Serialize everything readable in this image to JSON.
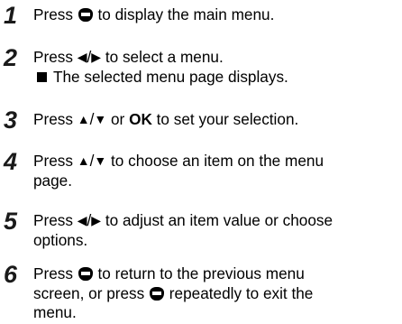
{
  "steps": [
    {
      "number": "1",
      "t1": "Press",
      "icon1": "menu-button-icon",
      "t2": "to display the main menu."
    },
    {
      "number": "2",
      "t1": "Press",
      "left": "◀",
      "slash": "/",
      "right": "▶",
      "t2": "to select a menu.",
      "bullet": "The selected menu page displays."
    },
    {
      "number": "3",
      "t1": "Press",
      "up": "▲",
      "slash": "/",
      "down": "▼",
      "t2": "or",
      "ok": "OK",
      "t3": "to set your selection."
    },
    {
      "number": "4",
      "t1": "Press",
      "up": "▲",
      "slash": "/",
      "down": "▼",
      "t2": "to choose an item on the menu",
      "t3": "page."
    },
    {
      "number": "5",
      "t1": "Press",
      "left": "◀",
      "slash": "/",
      "right": "▶",
      "t2": "to adjust an item value or choose",
      "t3": "options."
    },
    {
      "number": "6",
      "t1": "Press",
      "t2": "to return to the previous menu",
      "t3": "screen, or press",
      "t4": "repeatedly to exit the",
      "t5": "menu."
    }
  ]
}
